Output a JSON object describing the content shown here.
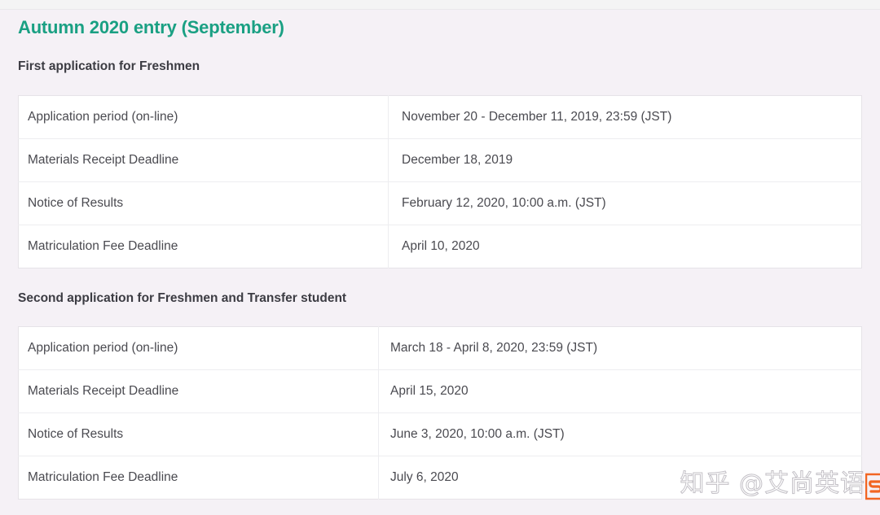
{
  "page": {
    "title": "Autumn 2020 entry (September)",
    "title_color": "#1aa083",
    "background_color": "#f5f1f6"
  },
  "sections": [
    {
      "heading": "First application for Freshmen",
      "rows": [
        {
          "label": "Application period (on-line)",
          "value": "November 20 - December 11, 2019, 23:59 (JST)"
        },
        {
          "label": "Materials Receipt Deadline",
          "value": "December 18, 2019"
        },
        {
          "label": "Notice of Results",
          "value": "February 12, 2020, 10:00 a.m. (JST)"
        },
        {
          "label": "Matriculation Fee Deadline",
          "value": "April 10, 2020"
        }
      ]
    },
    {
      "heading": "Second application for Freshmen and Transfer student",
      "rows": [
        {
          "label": "Application period (on-line)",
          "value": "March 18 - April 8, 2020, 23:59 (JST)"
        },
        {
          "label": "Materials Receipt Deadline",
          "value": "April 15, 2020"
        },
        {
          "label": "Notice of Results",
          "value": "June 3, 2020, 10:00 a.m. (JST)"
        },
        {
          "label": "Matriculation Fee Deadline",
          "value": "July 6, 2020"
        }
      ]
    }
  ],
  "watermark": {
    "text": "知乎 @艾尚英语",
    "logo_color": "#f26522"
  }
}
